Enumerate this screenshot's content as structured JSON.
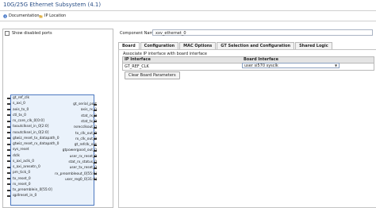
{
  "window": {
    "title": "10G/25G Ethernet Subsystem (4.1)"
  },
  "top_tabs": [
    {
      "label": "Documentation",
      "icon": "info-icon"
    },
    {
      "label": "IP Location",
      "icon": "folder-icon"
    }
  ],
  "left": {
    "show_disabled_ports_label": "Show disabled ports",
    "left_ports": [
      "gt_ref_clk",
      "s_axi_0",
      "axis_tx_0",
      "ctl_tx_0",
      "rx_core_clk_0[0:0]",
      "txoutclksel_in_0[2:0]",
      "rxoutclksel_in_0[2:0]",
      "gtwiz_reset_tx_datapath_0",
      "gtwiz_reset_rx_datapath_0",
      "sys_reset",
      "dclk",
      "s_axi_aclk_0",
      "s_axi_aresetn_0",
      "pm_tick_0",
      "tx_reset_0",
      "rx_reset_0",
      "tx_preamblein_0[55:0]",
      "qpllreset_in_0"
    ],
    "right_ports": [
      "gt_serial_port",
      "axis_rx_0",
      "stat_rx_0",
      "stat_tx_0",
      "rxrecclkout_0",
      "tx_clk_out_0",
      "rx_clk_out_0",
      "gt_refclk_out",
      "gtpowergood_out_0",
      "user_rx_reset_0",
      "stat_rx_status_0",
      "user_tx_reset_0",
      "rx_preambleout_0[55:0]",
      "user_reg0_0[31:0]"
    ]
  },
  "component": {
    "label": "Component Name",
    "value": "xxv_ethernet_0"
  },
  "config_tabs": [
    {
      "label": "Board",
      "active": true
    },
    {
      "label": "Configuration",
      "active": false
    },
    {
      "label": "MAC Options",
      "active": false
    },
    {
      "label": "GT Selection and Configuration",
      "active": false
    },
    {
      "label": "Shared Logic",
      "active": false
    }
  ],
  "board": {
    "associate_label": "Associate IP interface with board interface",
    "table_headers": [
      "IP Interface",
      "Board Interface"
    ],
    "rows": [
      {
        "ip_interface": "GT_REF_CLK",
        "board_interface": "user si570 sysclk"
      }
    ],
    "clear_button": "Clear Board Parameters"
  },
  "colors": {
    "title": "#2a4f87",
    "ip_block_fill": "#eaf2fb",
    "ip_block_border": "#4c78c0"
  }
}
